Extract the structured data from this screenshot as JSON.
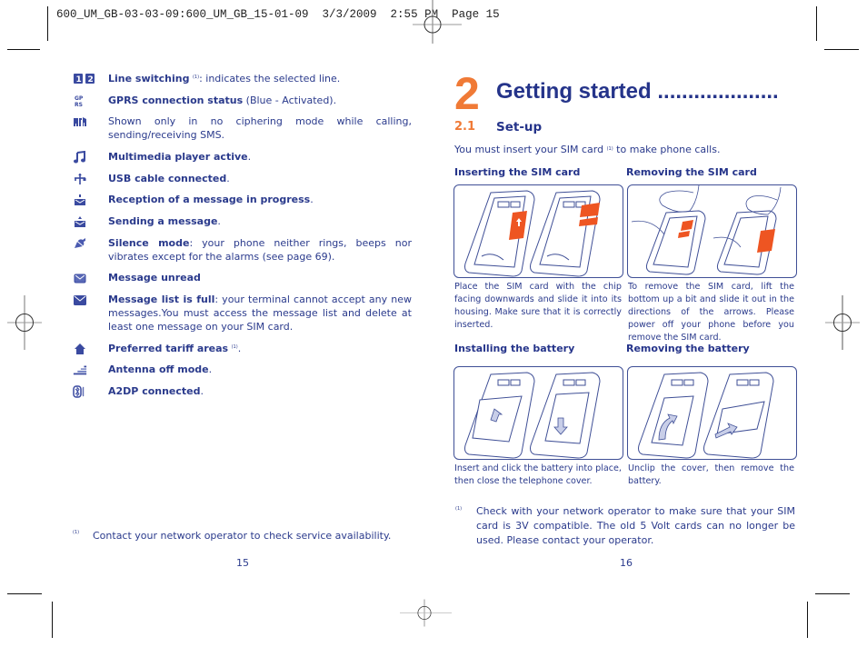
{
  "slug": {
    "text": "600_UM_GB-03-03-09:600_UM_GB_15-01-09  3/3/2009  2:55 PM  Page 15"
  },
  "left_page": {
    "icon_list": [
      {
        "icon": "line-switching-icon",
        "bold": "Line switching",
        "sup": "(1)",
        "rest": ": indicates the selected line."
      },
      {
        "icon": "gprs-icon",
        "bold": "GPRS connection status",
        "sup": "",
        "rest": " (Blue - Activated)."
      },
      {
        "icon": "no-ciphering-icon",
        "bold": "",
        "sup": "",
        "rest": "Shown only in no ciphering mode while calling, sending/receiving SMS."
      },
      {
        "icon": "music-note-icon",
        "bold": "Multimedia player active",
        "sup": "",
        "rest": "."
      },
      {
        "icon": "usb-icon",
        "bold": "USB cable connected",
        "sup": "",
        "rest": "."
      },
      {
        "icon": "message-receiving-icon",
        "bold": "Reception of a message in progress",
        "sup": "",
        "rest": "."
      },
      {
        "icon": "message-sending-icon",
        "bold": "Sending a message",
        "sup": "",
        "rest": "."
      },
      {
        "icon": "silence-mode-icon",
        "bold": "Silence mode",
        "sup": "",
        "rest": ": your phone neither rings, beeps nor vibrates except for the alarms (see page 69)."
      },
      {
        "icon": "envelope-icon",
        "bold": "Message unread",
        "sup": "",
        "rest": ""
      },
      {
        "icon": "envelope-full-icon",
        "bold": "Message list is full",
        "sup": "",
        "rest": ": your terminal cannot accept any new messages.You must access the message list and delete at least one message on your SIM card."
      },
      {
        "icon": "home-icon",
        "bold": "Preferred tariff areas",
        "sup": "(1)",
        "rest": "."
      },
      {
        "icon": "antenna-off-icon",
        "bold": "Antenna off mode",
        "sup": "",
        "rest": "."
      },
      {
        "icon": "bluetooth-a2dp-icon",
        "bold": "A2DP connected",
        "sup": "",
        "rest": "."
      }
    ],
    "footnote": {
      "mark": "(1)",
      "text": "Contact your network operator to check service availability."
    },
    "page_number": "15"
  },
  "right_page": {
    "chapter_number": "2",
    "chapter_title": "Getting started ....................",
    "section_number": "2.1",
    "section_title": "Set-up",
    "intro": {
      "before": "You must insert your SIM card ",
      "sup": "(1)",
      "after": " to make phone calls."
    },
    "figures": [
      {
        "heading": "Inserting the SIM card",
        "caption": "Place the SIM card with the chip facing downwards and slide it into its housing. Make sure that it is correctly inserted."
      },
      {
        "heading": "Removing the SIM card",
        "caption": "To remove the SIM card, lift the bottom up a bit and slide it out in the directions of the arrows. Please power off your phone before you remove the SIM card."
      },
      {
        "heading": "Installing the battery",
        "caption": "Insert and click the battery into place, then close the telephone cover."
      },
      {
        "heading": "Removing the battery",
        "caption": "Unclip the cover, then remove the battery."
      }
    ],
    "footnote": {
      "mark": "(1)",
      "text": "Check with your network operator to make sure that your SIM card is 3V compatible. The old 5 Volt cards can no longer be used. Please contact your operator."
    },
    "page_number": "16"
  },
  "colors": {
    "text": "#2a3a8c",
    "heading": "#25348a",
    "accent_orange": "#f07a36",
    "figure_border": "#3f4f96"
  }
}
